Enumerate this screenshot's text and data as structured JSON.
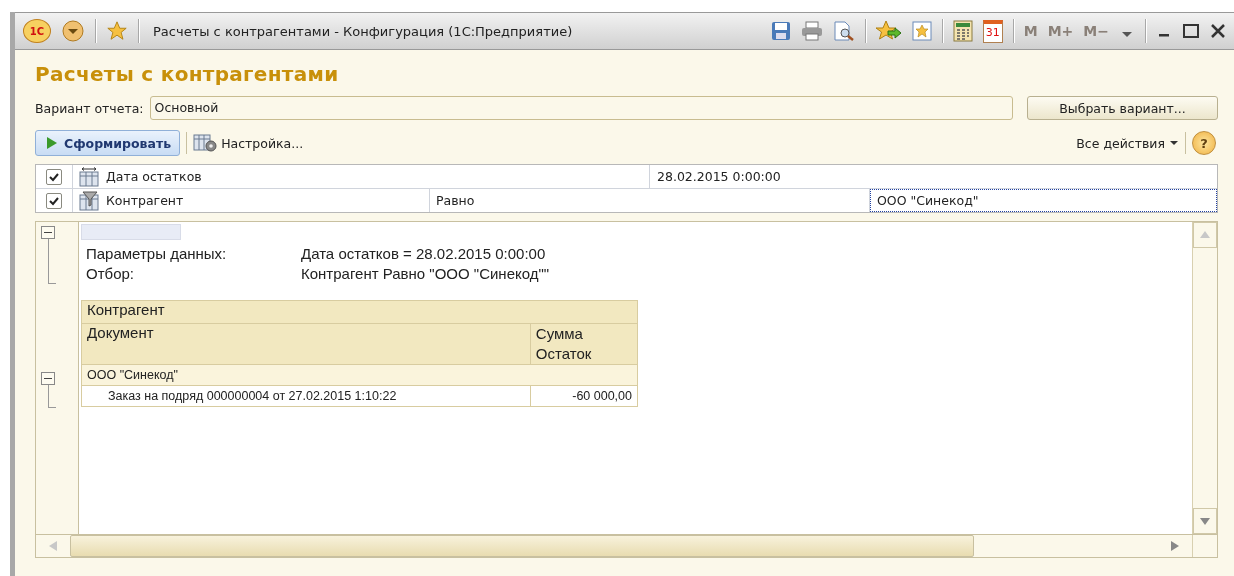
{
  "window": {
    "logo": "1С",
    "title": "Расчеты с контрагентами - Конфигурация  (1С:Предприятие)",
    "calendar_day": "31",
    "memory_buttons": [
      {
        "label": "M",
        "disabled": true
      },
      {
        "label": "M+",
        "disabled": true
      },
      {
        "label": "M−",
        "disabled": true
      }
    ]
  },
  "heading": "Расчеты с контрагентами",
  "variant": {
    "label": "Вариант отчета:",
    "value": "Основной",
    "button": "Выбрать вариант..."
  },
  "toolbar": {
    "generate": "Сформировать",
    "settings": "Настройка...",
    "all_actions": "Все действия",
    "help": "?"
  },
  "filters": [
    {
      "kind": "parameter",
      "checked": true,
      "field": "Дата остатков",
      "value": "28.02.2015 0:00:00",
      "focused": false
    },
    {
      "kind": "filter",
      "checked": true,
      "field": "Контрагент",
      "condition": "Равно",
      "value": "ООО \"Синекод\"",
      "focused": true
    }
  ],
  "report": {
    "params": [
      {
        "label": "Параметры данных:",
        "value": "Дата остатков = 28.02.2015 0:00:00"
      },
      {
        "label": "Отбор:",
        "value": "Контрагент Равно \"ООО \"Синекод\"\""
      }
    ],
    "group_header": "Контрагент",
    "columns": [
      "Документ",
      "Сумма Остаток"
    ],
    "groups": [
      {
        "name": "ООО \"Синекод\"",
        "expanded": true,
        "rows": [
          {
            "document": "Заказ на подряд 000000004 от 27.02.2015 1:10:22",
            "amount": "-60 000,00"
          }
        ]
      }
    ]
  }
}
